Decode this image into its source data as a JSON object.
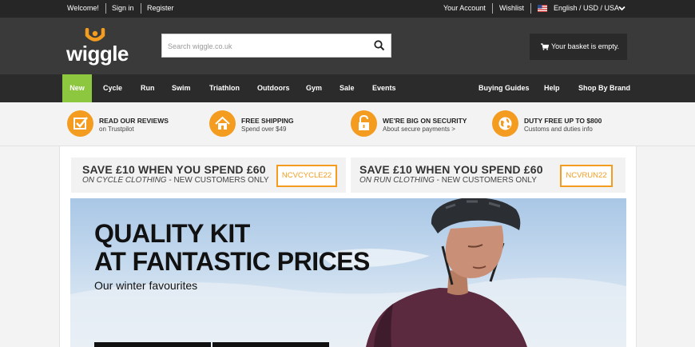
{
  "topbar": {
    "welcome": "Welcome!",
    "sign_in": "Sign in",
    "register": "Register",
    "account": "Your Account",
    "wishlist": "Wishlist",
    "locale": "English / USD / USA"
  },
  "header": {
    "logo_text": "wiggle",
    "search_placeholder": "Search wiggle.co.uk",
    "basket": "Your basket is empty."
  },
  "nav": {
    "items": [
      "New",
      "Cycle",
      "Run",
      "Swim",
      "Triathlon",
      "Outdoors",
      "Gym",
      "Sale",
      "Events"
    ],
    "right": [
      "Buying Guides",
      "Help",
      "Shop By Brand"
    ]
  },
  "usp": [
    {
      "title": "READ OUR REVIEWS",
      "sub": "on Trustpilot",
      "icon": "trustpilot-icon"
    },
    {
      "title": "FREE SHIPPING",
      "sub": "Spend over $49",
      "icon": "home-icon"
    },
    {
      "title": "WE'RE BIG ON SECURITY",
      "sub": "About secure payments >",
      "icon": "padlock-icon"
    },
    {
      "title": "DUTY FREE UP TO $800",
      "sub": "Customs and duties info",
      "icon": "globe-icon"
    }
  ],
  "promos": [
    {
      "headline": "SAVE £10 WHEN YOU SPEND £60",
      "emph": "ON CYCLE CLOTHING",
      "rest": " - NEW CUSTOMERS ONLY",
      "code": "NCVCYCLE22"
    },
    {
      "headline": "SAVE £10 WHEN YOU SPEND £60",
      "emph": "ON RUN CLOTHING",
      "rest": " - NEW CUSTOMERS ONLY",
      "code": "NCVRUN22"
    }
  ],
  "hero": {
    "line1": "QUALITY KIT",
    "line2": "AT FANTASTIC PRICES",
    "subtitle": "Our winter favourites"
  },
  "colors": {
    "accent": "#f39c1f",
    "nav_active": "#8dc63f",
    "header_bg": "#3a3a3a",
    "topbar_bg": "#262626"
  }
}
